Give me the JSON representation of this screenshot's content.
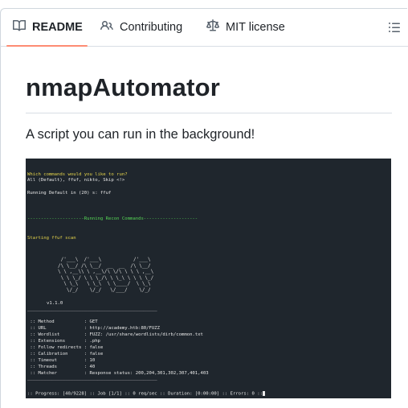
{
  "tabs": [
    {
      "label": "README",
      "icon": "book-icon",
      "active": true
    },
    {
      "label": "Contributing",
      "icon": "people-icon",
      "active": false
    },
    {
      "label": "MIT license",
      "icon": "law-icon",
      "active": false
    }
  ],
  "outline_icon": "list-unordered-icon",
  "readme": {
    "title": "nmapAutomator",
    "description": "A script you can run in the background!"
  },
  "terminal": {
    "prompt_question": "Which commands would you like to run?",
    "prompt_options": "All (Default), ffuf, nikto, Skip <!>",
    "running_default": "Running Default in (20) s: ffuf",
    "recon_banner": "---------------------Running Recon Commands--------------------",
    "starting": "Starting ffuf scan",
    "ascii_art": "      /'___\\  /'___\\           /'___\\\n     /\\ \\__/ /\\ \\__/  __  __  /\\ \\__/\n     \\ \\ ,__\\\\ \\ ,__\\/\\ \\/\\ \\ \\ \\ ,__\\\n      \\ \\ \\_/ \\ \\ \\_/\\ \\ \\_\\ \\ \\ \\ \\_/\n       \\ \\_\\   \\ \\_\\  \\ \\____/  \\ \\_\\\n        \\/_/    \\/_/   \\/___/    \\/_/",
    "version": "v1.1.0",
    "divider": "________________________________________________",
    "config_lines": [
      " :: Method           : GET",
      " :: URL              : http://academy.htb:80/FUZZ",
      " :: Wordlist         : FUZZ: /usr/share/wordlists/dirb/common.txt",
      " :: Extensions       : .php",
      " :: Follow redirects : false",
      " :: Calibration      : false",
      " :: Timeout          : 10",
      " :: Threads          : 40",
      " :: Matcher          : Response status: 200,204,301,302,307,401,403"
    ],
    "divider2": "________________________________________________",
    "progress": ":: Progress: [40/9228] :: Job [1/1] :: 0 req/sec :: Duration: [0:00:00] :: Errors: 0 ::"
  },
  "colors": {
    "tab_underline": "#fd8c73",
    "terminal_bg": "#1f262d",
    "terminal_yellow": "#e4d34a",
    "terminal_green": "#55d655"
  }
}
